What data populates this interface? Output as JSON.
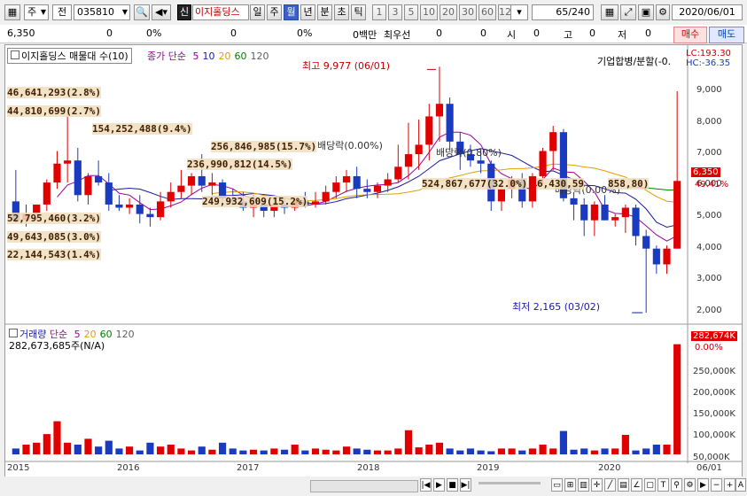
{
  "toolbar": {
    "menu_icon": "chart-menu-icon",
    "mode_select": "주",
    "type_select": "전",
    "code": "035810",
    "new_label": "신",
    "stock_name": "이지홀딩스",
    "periods": [
      "일",
      "주",
      "월",
      "년",
      "분",
      "초",
      "틱"
    ],
    "active_period": "월",
    "intervals": [
      "1",
      "3",
      "5",
      "10",
      "20",
      "30",
      "60",
      "120"
    ],
    "count": "65",
    "count_total": "/240",
    "date": "2020/06/01"
  },
  "quote": {
    "price": "6,350",
    "change": "0",
    "change_pct": "0%",
    "v1": "0",
    "v1_pct": "0%",
    "amount": "0백만",
    "best_bid_label": "최우선",
    "best_bid": "0",
    "open_label": "시",
    "open": "0",
    "high_label": "고",
    "high": "0",
    "low_label": "저",
    "low": "0",
    "buy_label": "매수",
    "sell_label": "매도"
  },
  "price_panel": {
    "legend_name": "이지홀딩스 매물대 수(10)",
    "legend_ma_title": "종가 단순",
    "ma_labels": [
      "5",
      "10",
      "20",
      "60",
      "120"
    ],
    "ma_colors": [
      "#9c009c",
      "#1a1aa0",
      "#e0a000",
      "#008000",
      "#606060"
    ],
    "lc": "LC:193.30",
    "hc": "HC:-36.35",
    "corp_event": "기업합병/분할(-0.",
    "high_note": "최고 9,977 (06/01)",
    "low_note": "최저 2,165 (03/02)",
    "current_price": "6,350",
    "current_pct": "49.41%",
    "dividend_labels": [
      "배당락(0.00%)",
      "배당락(0.80%)",
      "배당락(0.00%)"
    ],
    "volume_profile": [
      "46,641,293(2.8%)",
      "44,810,699(2.7%)",
      "154,252,488(9.4%)",
      "256,846,985(15.7%)",
      "236,990,812(14.5%)",
      "524,867,677(32.0%)",
      "6,430,59",
      "858,80)",
      "249,932,609(15.2%)",
      "52,795,460(3.2%)",
      "49,643,085(3.0%)",
      "22,144,543(1.4%)"
    ],
    "y_ticks": [
      "9,000",
      "8,000",
      "7,000",
      "6,000",
      "5,000",
      "4,000",
      "3,000",
      "2,000"
    ]
  },
  "volume_panel": {
    "legend_name": "거래량",
    "legend_ma_title": "단순",
    "ma_labels": [
      "5",
      "20",
      "60",
      "120"
    ],
    "value_text": "282,673,685주(N/A)",
    "current_vol": "282,674K",
    "current_pct": "0.00%",
    "y_ticks": [
      "250,000K",
      "200,000K",
      "150,000K",
      "100,000K",
      "50,000K"
    ]
  },
  "x_axis": [
    "2015",
    "2016",
    "2017",
    "2018",
    "2019",
    "2020",
    "06/01"
  ],
  "chart_data": {
    "type": "candlestick",
    "x": [
      "2015-01",
      "2015-02",
      "2015-03",
      "2015-04",
      "2015-05",
      "2015-06",
      "2015-07",
      "2015-08",
      "2015-09",
      "2015-10",
      "2015-11",
      "2015-12",
      "2016-01",
      "2016-02",
      "2016-03",
      "2016-04",
      "2016-05",
      "2016-06",
      "2016-07",
      "2016-08",
      "2016-09",
      "2016-10",
      "2016-11",
      "2016-12",
      "2017-01",
      "2017-02",
      "2017-03",
      "2017-04",
      "2017-05",
      "2017-06",
      "2017-07",
      "2017-08",
      "2017-09",
      "2017-10",
      "2017-11",
      "2017-12",
      "2018-01",
      "2018-02",
      "2018-03",
      "2018-04",
      "2018-05",
      "2018-06",
      "2018-07",
      "2018-08",
      "2018-09",
      "2018-10",
      "2018-11",
      "2018-12",
      "2019-01",
      "2019-02",
      "2019-03",
      "2019-04",
      "2019-05",
      "2019-06",
      "2019-07",
      "2019-08",
      "2019-09",
      "2019-10",
      "2019-11",
      "2019-12",
      "2020-01",
      "2020-02",
      "2020-03",
      "2020-04",
      "2020-05"
    ],
    "open": [
      5700,
      5100,
      5300,
      5600,
      6300,
      6900,
      7000,
      5900,
      6500,
      6300,
      5600,
      5500,
      5600,
      5300,
      5200,
      5700,
      6000,
      6200,
      6500,
      6200,
      6300,
      5800,
      5700,
      5500,
      5600,
      5400,
      5600,
      5500,
      5700,
      5600,
      5700,
      6000,
      6300,
      6500,
      6100,
      6000,
      6200,
      6400,
      6800,
      7200,
      7500,
      8400,
      8800,
      7600,
      7200,
      7000,
      6900,
      5700,
      6100,
      6400,
      5700,
      6500,
      7300,
      7900,
      5800,
      5600,
      5100,
      5600,
      5100,
      5200,
      5500,
      4600,
      4200,
      3700,
      4200
    ],
    "high": [
      6700,
      5600,
      5600,
      6400,
      7300,
      8500,
      7400,
      6600,
      7000,
      6600,
      5900,
      5800,
      5900,
      5500,
      6000,
      6300,
      6700,
      6600,
      7200,
      6600,
      6400,
      6100,
      6000,
      5900,
      5700,
      5800,
      5800,
      5800,
      6000,
      6000,
      6200,
      6500,
      6700,
      6800,
      6400,
      6300,
      6600,
      7500,
      8200,
      8300,
      8800,
      9977,
      9000,
      7900,
      7500,
      7300,
      7000,
      6300,
      6500,
      6600,
      6600,
      7400,
      8100,
      8000,
      6000,
      5800,
      5700,
      5900,
      5300,
      5600,
      5600,
      4800,
      4300,
      4300,
      9200
    ],
    "low": [
      5000,
      4900,
      5100,
      5400,
      6100,
      6300,
      5700,
      5600,
      6200,
      5400,
      5400,
      5300,
      5000,
      4900,
      5100,
      5500,
      5800,
      5900,
      6000,
      5900,
      5700,
      5600,
      5400,
      5200,
      5200,
      5200,
      5300,
      5400,
      5500,
      5500,
      5600,
      5800,
      6000,
      5800,
      5800,
      5800,
      6000,
      6300,
      6400,
      6700,
      7000,
      7600,
      7300,
      6700,
      6800,
      6600,
      5400,
      5400,
      5800,
      5500,
      5500,
      6200,
      6700,
      5700,
      5100,
      4600,
      4600,
      5100,
      4900,
      4700,
      4300,
      2165,
      3400,
      3400,
      4200
    ],
    "close": [
      5100,
      5300,
      5600,
      6300,
      6900,
      7000,
      5900,
      6500,
      6300,
      5600,
      5500,
      5600,
      5300,
      5200,
      5700,
      6000,
      6200,
      6500,
      6200,
      6300,
      5800,
      5700,
      5500,
      5600,
      5400,
      5600,
      5500,
      5700,
      5600,
      5700,
      6000,
      6300,
      6500,
      6100,
      6000,
      6200,
      6400,
      6800,
      7200,
      7500,
      8400,
      8800,
      7600,
      7200,
      7000,
      6900,
      5700,
      6100,
      6400,
      5700,
      6500,
      7300,
      7900,
      5800,
      5600,
      5100,
      5600,
      5100,
      5200,
      5500,
      4600,
      4200,
      3700,
      4200,
      6350
    ],
    "volume_k": [
      15000,
      25000,
      30000,
      52000,
      85000,
      30000,
      25000,
      40000,
      20000,
      35000,
      15000,
      20000,
      10000,
      30000,
      20000,
      25000,
      15000,
      10000,
      20000,
      12000,
      30000,
      15000,
      10000,
      12000,
      10000,
      15000,
      12000,
      25000,
      10000,
      15000,
      12000,
      10000,
      20000,
      15000,
      12000,
      10000,
      10000,
      15000,
      62000,
      18000,
      25000,
      30000,
      15000,
      10000,
      15000,
      10000,
      8000,
      15000,
      15000,
      10000,
      15000,
      25000,
      15000,
      60000,
      12000,
      15000,
      10000,
      15000,
      15000,
      50000,
      10000,
      15000,
      25000,
      25000,
      282674
    ],
    "ylim": [
      1800,
      10100
    ],
    "volume_ylim_k": [
      0,
      300000
    ]
  }
}
